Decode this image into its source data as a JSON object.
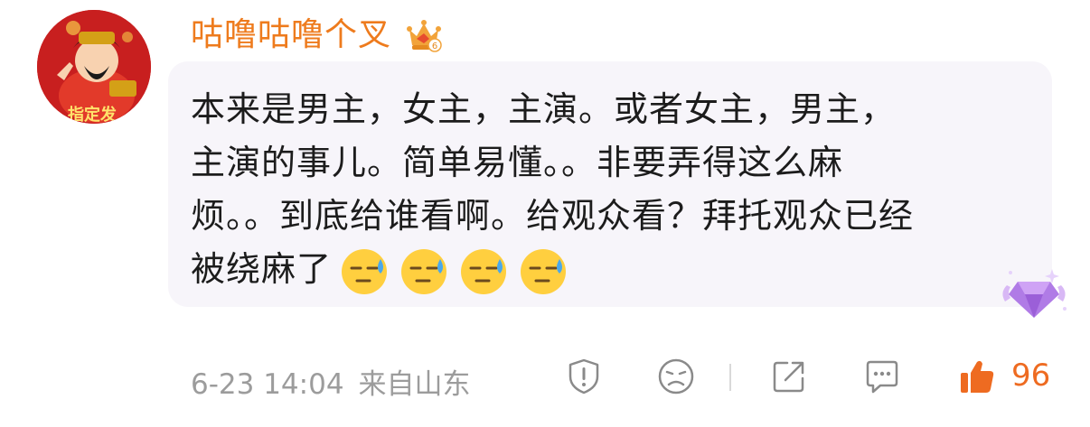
{
  "comment": {
    "username": "咕噜咕噜个叉",
    "avatar_text": "指定发",
    "crown_level": "6",
    "lines": [
      "本来是男主，女主，主演。或者女主，男主，",
      "主演的事儿。简单易懂。。非要弄得这么麻",
      "烦。。到底给谁看啊。给观众看？拜托观众已经",
      "被绕麻了"
    ],
    "emoji_name": "sweat-emoji",
    "emoji_count": 4,
    "date": "6-23 14:04",
    "location": "来自山东",
    "likes": "96"
  },
  "colors": {
    "username": "#ee7b1d",
    "text": "#1c1c1c",
    "meta": "#9c9c9c",
    "like": "#ee6b21",
    "bubble": "#f7f5fa",
    "gem": "#b07be6"
  },
  "icons": [
    "report-icon",
    "dislike-face-icon",
    "share-icon",
    "reply-icon",
    "thumbs-up-icon"
  ]
}
